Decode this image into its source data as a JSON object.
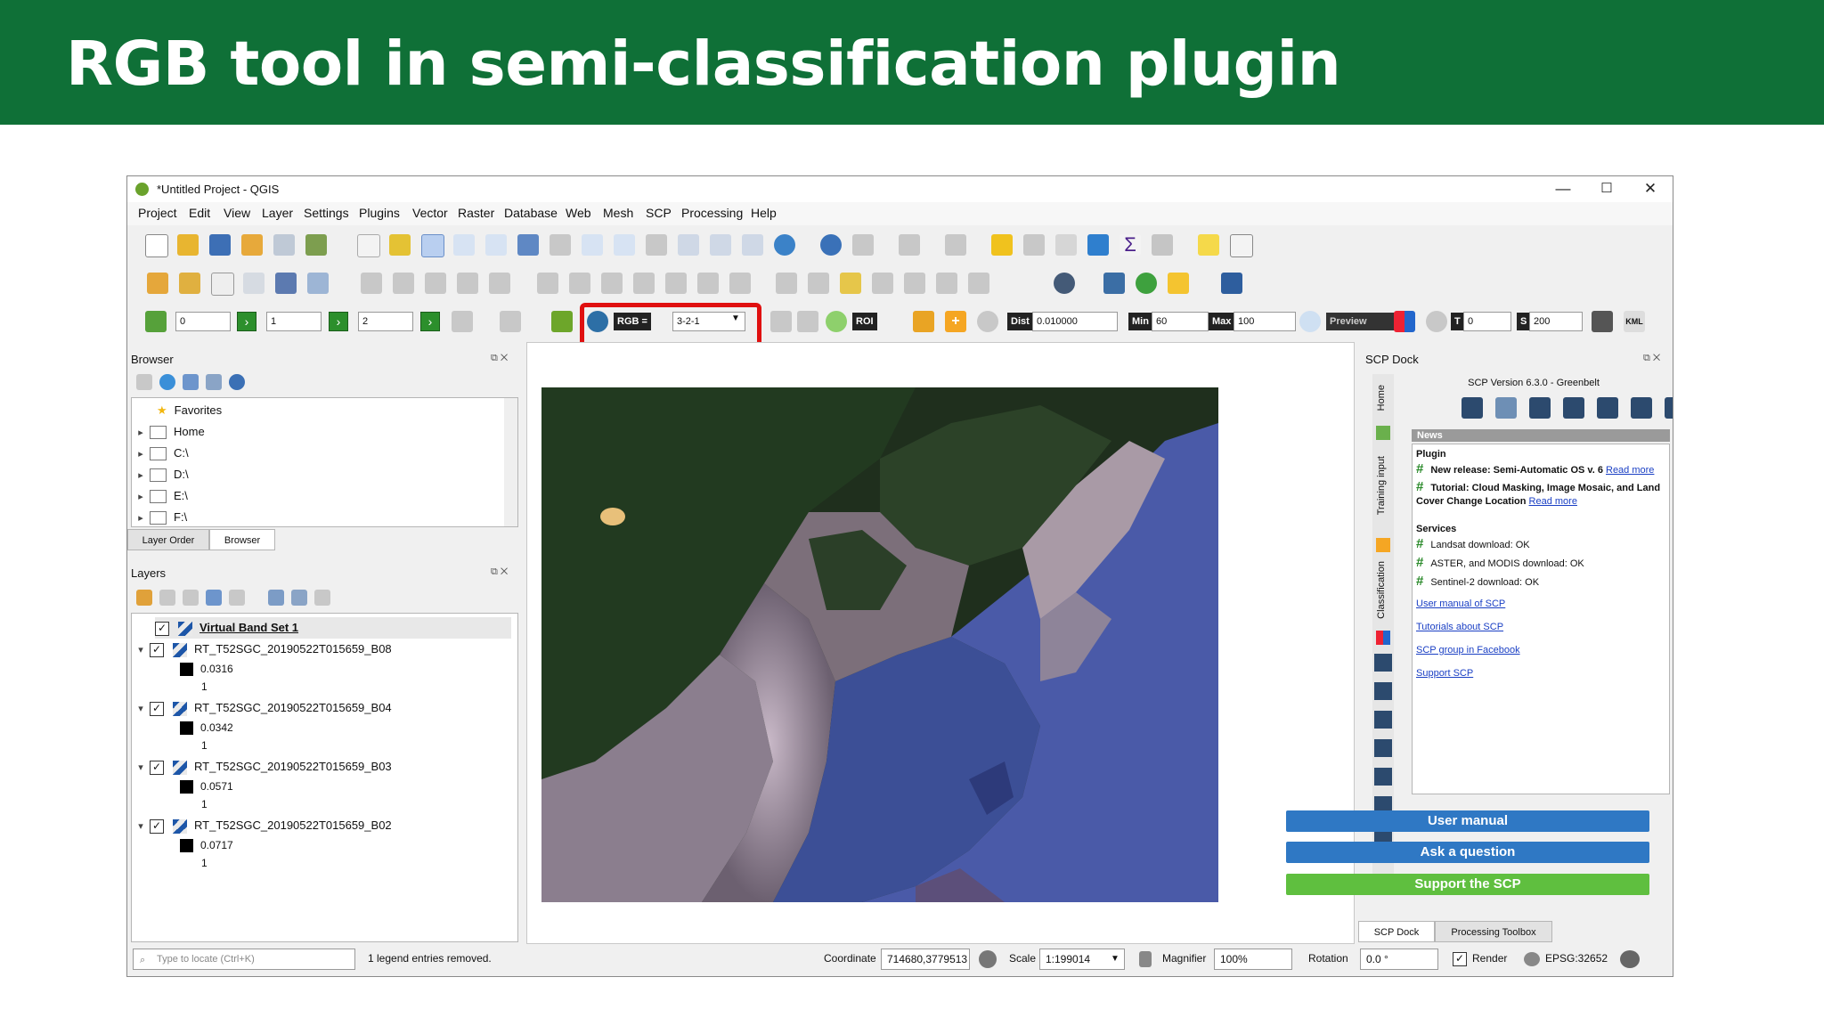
{
  "slide": {
    "title": "RGB tool in semi-classification plugin"
  },
  "window": {
    "title": "*Untitled Project - QGIS",
    "minimize": "—",
    "maximize": "☐",
    "close": "✕"
  },
  "menu": [
    "Project",
    "Edit",
    "View",
    "Layer",
    "Settings",
    "Plugins",
    "Vector",
    "Raster",
    "Database",
    "Web",
    "Mesh",
    "SCP",
    "Processing",
    "Help"
  ],
  "scp_toolbar": {
    "band_spins": [
      "0",
      "1",
      "2"
    ],
    "rgb_label": "RGB =",
    "rgb_value": "3-2-1",
    "roi_label": "ROI",
    "dist_label": "Dist",
    "dist_value": "0.010000",
    "min_label": "Min",
    "min_value": "60",
    "max_label": "Max",
    "max_value": "100",
    "preview_label": "Preview",
    "t_label": "T",
    "t_value": "0",
    "s_label": "S",
    "s_value": "200",
    "kml_label": "KML",
    "highlight_color": "#e01010"
  },
  "browser": {
    "title": "Browser",
    "items": [
      "Favorites",
      "Home",
      "C:\\",
      "D:\\",
      "E:\\",
      "F:\\"
    ],
    "tabs": [
      "Layer Order",
      "Browser"
    ]
  },
  "layers": {
    "title": "Layers",
    "items": [
      {
        "name": "Virtual Band Set 1"
      },
      {
        "name": "RT_T52SGC_20190522T015659_B08",
        "min": "0.0316",
        "max": "1"
      },
      {
        "name": "RT_T52SGC_20190522T015659_B04",
        "min": "0.0342",
        "max": "1"
      },
      {
        "name": "RT_T52SGC_20190522T015659_B03",
        "min": "0.0571",
        "max": "1"
      },
      {
        "name": "RT_T52SGC_20190522T015659_B02",
        "min": "0.0717",
        "max": "1"
      }
    ]
  },
  "scp_dock": {
    "title": "SCP Dock",
    "version": "SCP Version 6.3.0 - Greenbelt",
    "side_tabs": [
      "Home",
      "Training input",
      "Classification"
    ],
    "news_header": "News",
    "plugin_header": "Plugin",
    "news": [
      {
        "text": "New release: Semi-Automatic OS v. 6",
        "link": "Read more"
      },
      {
        "text": "Tutorial: Cloud Masking, Image Mosaic, and Land Cover Change Location",
        "link": "Read more"
      }
    ],
    "services_header": "Services",
    "services": [
      "Landsat download: OK",
      "ASTER, and MODIS download: OK",
      "Sentinel-2 download: OK"
    ],
    "links": [
      "User manual of SCP",
      "Tutorials about SCP",
      "SCP group in Facebook",
      "Support SCP"
    ],
    "buttons": {
      "user_manual": "User manual",
      "ask": "Ask a question",
      "support": "Support the SCP"
    },
    "bottom_tabs": [
      "SCP Dock",
      "Processing Toolbox"
    ]
  },
  "status": {
    "locate_placeholder": "Type to locate (Ctrl+K)",
    "message": "1 legend entries removed.",
    "coordinate_label": "Coordinate",
    "coordinate_value": "714680,3779513",
    "scale_label": "Scale",
    "scale_value": "1:199014",
    "magnifier_label": "Magnifier",
    "magnifier_value": "100%",
    "rotation_label": "Rotation",
    "rotation_value": "0.0 °",
    "render_label": "Render",
    "crs": "EPSG:32652"
  }
}
